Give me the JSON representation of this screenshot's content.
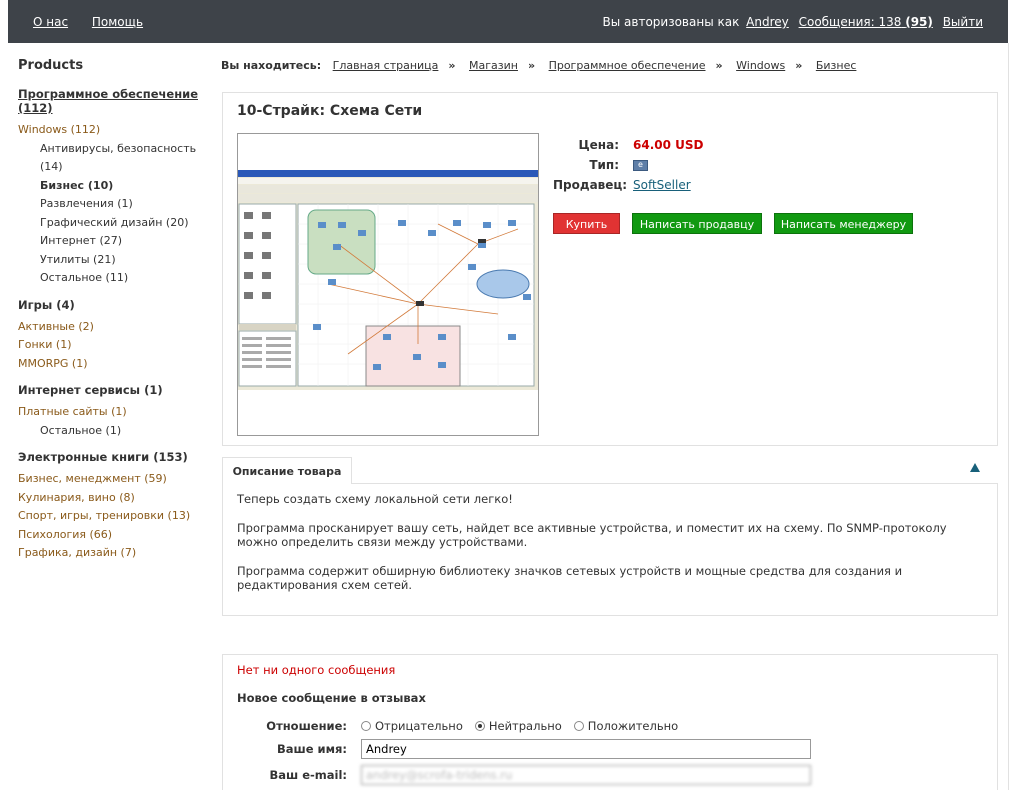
{
  "topbar": {
    "links": [
      "О нас",
      "Помощь"
    ],
    "auth_text": "Вы авторизованы как",
    "user": "Andrey",
    "messages_label": "Сообщения: 138",
    "messages_unread": "(95)",
    "logout": "Выйти"
  },
  "sidebar": {
    "title": "Products",
    "categories": [
      {
        "name": "Программное обеспечение (112)",
        "items": [
          {
            "label": "Windows (112)",
            "level": 1
          },
          {
            "label": "Антивирусы, безопасность (14)",
            "level": 2
          },
          {
            "label": "Бизнес  (10)",
            "level": 2,
            "active": true
          },
          {
            "label": "Развлечения (1)",
            "level": 2
          },
          {
            "label": "Графический дизайн (20)",
            "level": 2
          },
          {
            "label": "Интернет (27)",
            "level": 2
          },
          {
            "label": "Утилиты (21)",
            "level": 2
          },
          {
            "label": "Остальное (11)",
            "level": 2
          }
        ]
      },
      {
        "name": "Игры (4)",
        "items": [
          {
            "label": "Активные (2)",
            "level": 1
          },
          {
            "label": "Гонки (1)",
            "level": 1
          },
          {
            "label": "MMORPG (1)",
            "level": 1
          }
        ]
      },
      {
        "name": "Интернет сервисы (1)",
        "items": [
          {
            "label": "Платные сайты (1)",
            "level": 1
          },
          {
            "label": "Остальное (1)",
            "level": 2
          }
        ]
      },
      {
        "name": "Электронные книги (153)",
        "items": [
          {
            "label": "Бизнес, менеджмент (59)",
            "level": 1
          },
          {
            "label": "Кулинария, вино (8)",
            "level": 1
          },
          {
            "label": "Спорт, игры, тренировки (13)",
            "level": 1
          },
          {
            "label": "Психология (66)",
            "level": 1
          },
          {
            "label": "Графика, дизайн (7)",
            "level": 1
          }
        ]
      }
    ]
  },
  "breadcrumb": {
    "label": "Вы находитесь:",
    "items": [
      "Главная страница",
      "Магазин",
      "Программное обеспечение",
      "Windows",
      "Бизнес"
    ],
    "separator": "»"
  },
  "product": {
    "title": "10-Страйк: Схема Сети",
    "price_label": "Цена:",
    "price": "64.00 USD",
    "type_label": "Тип:",
    "seller_label": "Продавец:",
    "seller": "SoftSeller",
    "buy": "Купить",
    "write_seller": "Написать продавцу",
    "write_manager": "Написать менеджеру"
  },
  "description": {
    "tab": "Описание товара",
    "paragraphs": [
      "Теперь создать схему локальной сети легко!",
      "Программа просканирует вашу сеть, найдет все активные устройства, и поместит их на схему. По SNMP-протоколу можно определить связи между устройствами.",
      "Программа содержит обширную библиотеку значков сетевых устройств и мощные средства для создания и редактирования схем сетей."
    ]
  },
  "reviews": {
    "none": "Нет ни одного сообщения",
    "new_title": "Новое сообщение в отзывах",
    "attitude_label": "Отношение:",
    "options": [
      "Отрицательно",
      "Нейтрально",
      "Положительно"
    ],
    "selected": "Нейтрально",
    "name_label": "Ваше имя:",
    "name_value": "Andrey",
    "email_label": "Ваш e-mail:",
    "email_value": "andrey@scrofa-tridens.ru"
  },
  "colors": {
    "topbar": "#3e4349",
    "link_brown": "#8a5a1a",
    "price": "#cc0000",
    "buy": "#e13333",
    "green": "#119911"
  }
}
